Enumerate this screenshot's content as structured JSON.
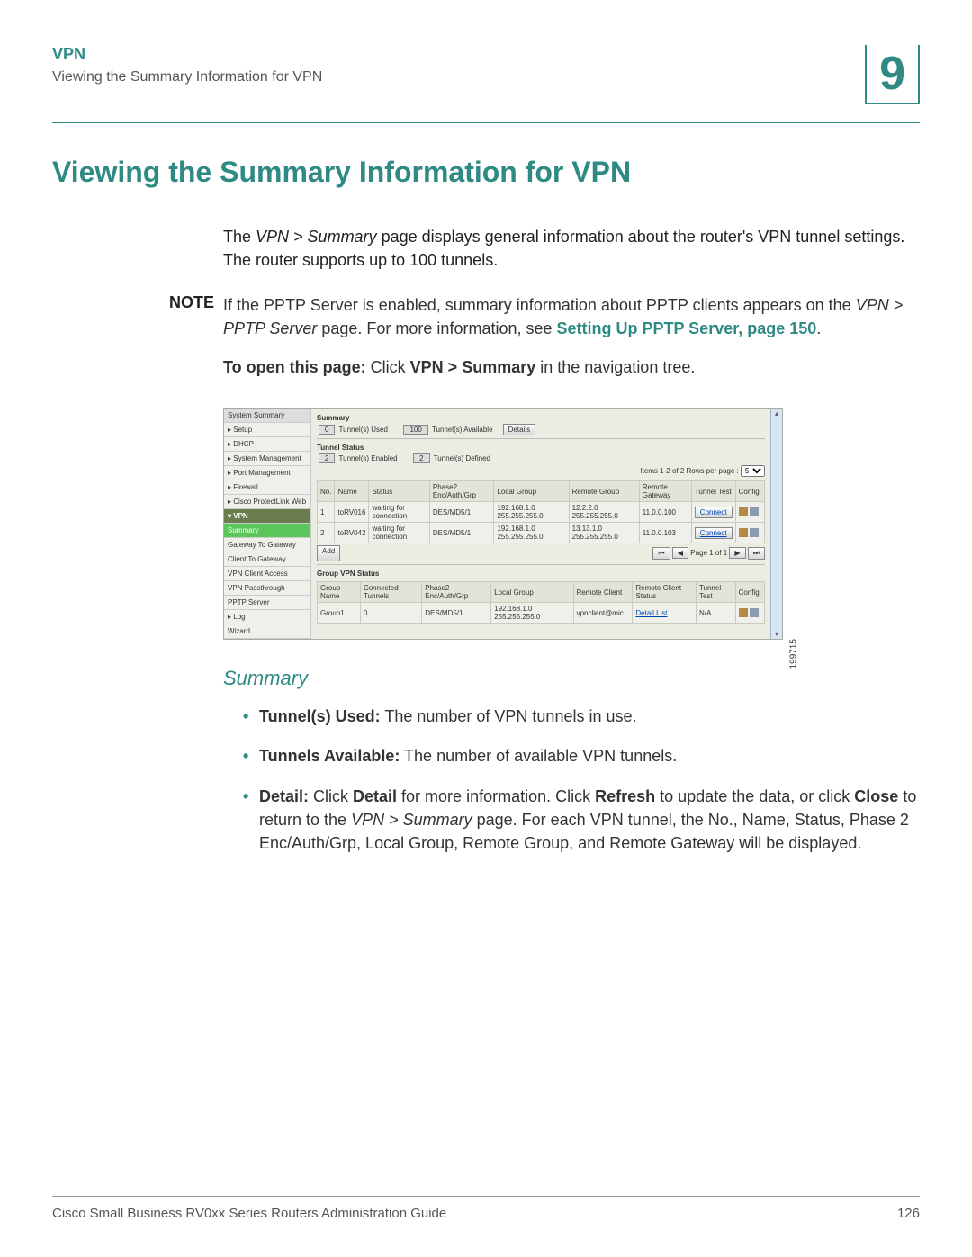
{
  "header": {
    "section": "VPN",
    "subtitle": "Viewing the Summary Information for VPN",
    "chapter": "9"
  },
  "title": "Viewing the Summary Information for VPN",
  "intro": {
    "pre": "The ",
    "path": "VPN > Summary",
    "post": " page displays general information about the router's VPN tunnel settings. The router supports up to 100 tunnels."
  },
  "note": {
    "label": "NOTE",
    "pre": "If the PPTP Server is enabled, summary information about PPTP clients appears on the ",
    "path": "VPN > PPTP Server",
    "post": " page. For more information, see ",
    "link": "Setting Up PPTP Server, page 150",
    "tail": "."
  },
  "open": {
    "lead": "To open this page:",
    "pre": " Click ",
    "path": "VPN > Summary",
    "post": " in the navigation tree."
  },
  "shot": {
    "id": "199715",
    "nav": [
      {
        "label": "System Summary",
        "cls": "top"
      },
      {
        "label": "▸ Setup",
        "cls": ""
      },
      {
        "label": "▸ DHCP",
        "cls": ""
      },
      {
        "label": "▸ System Management",
        "cls": ""
      },
      {
        "label": "▸ Port Management",
        "cls": ""
      },
      {
        "label": "▸ Firewall",
        "cls": ""
      },
      {
        "label": "▸ Cisco ProtectLink Web",
        "cls": ""
      },
      {
        "label": "▾ VPN",
        "cls": "hdr"
      },
      {
        "label": "Summary",
        "cls": "active"
      },
      {
        "label": "Gateway To Gateway",
        "cls": ""
      },
      {
        "label": "Client To Gateway",
        "cls": ""
      },
      {
        "label": "VPN Client Access",
        "cls": ""
      },
      {
        "label": "VPN Passthrough",
        "cls": ""
      },
      {
        "label": "PPTP Server",
        "cls": ""
      },
      {
        "label": "▸ Log",
        "cls": ""
      },
      {
        "label": "Wizard",
        "cls": ""
      }
    ],
    "summary": {
      "title": "Summary",
      "used_val": "0",
      "used_lbl": "Tunnel(s) Used",
      "avail_val": "100",
      "avail_lbl": "Tunnel(s) Available",
      "details_btn": "Details"
    },
    "tunnel_status": {
      "title": "Tunnel Status",
      "enabled_val": "2",
      "enabled_lbl": "Tunnel(s) Enabled",
      "defined_val": "2",
      "defined_lbl": "Tunnel(s) Defined",
      "range": "Items 1-2 of 2  Rows per page :",
      "rows_select": "5",
      "headers": [
        "No.",
        "Name",
        "Status",
        "Phase2 Enc/Auth/Grp",
        "Local Group",
        "Remote Group",
        "Remote Gateway",
        "Tunnel Test",
        "Config."
      ],
      "rows": [
        {
          "no": "1",
          "name": "toRV016",
          "status": "waiting for connection",
          "phase": "DES/MD5/1",
          "local": "192.168.1.0 255.255.255.0",
          "remote": "12.2.2.0 255.255.255.0",
          "gw": "11.0.0.100",
          "test": "Connect"
        },
        {
          "no": "2",
          "name": "toRV042",
          "status": "waiting for connection",
          "phase": "DES/MD5/1",
          "local": "192.168.1.0 255.255.255.0",
          "remote": "13.13.1.0 255.255.255.0",
          "gw": "11.0.0.103",
          "test": "Connect"
        }
      ],
      "add_btn": "Add",
      "paging": "Page 1 of 1"
    },
    "group_vpn": {
      "title": "Group VPN Status",
      "headers": [
        "Group Name",
        "Connected Tunnels",
        "Phase2 Enc/Auth/Grp",
        "Local Group",
        "Remote Client",
        "Remote Client Status",
        "Tunnel Test",
        "Config."
      ],
      "row": {
        "name": "Group1",
        "ct": "0",
        "phase": "DES/MD5/1",
        "local": "192.168.1.0 255.255.255.0",
        "remote": "vpnclient@mic...",
        "status": "Detail List",
        "test": "N/A"
      }
    }
  },
  "summary_section": {
    "heading": "Summary",
    "b1_lead": "Tunnel(s) Used:",
    "b1_text": " The number of VPN tunnels in use.",
    "b2_lead": "Tunnels Available:",
    "b2_text": " The number of available VPN tunnels.",
    "b3_lead": "Detail:",
    "b3_pre": " Click ",
    "b3_d": "Detail",
    "b3_mid1": " for more information. Click ",
    "b3_r": "Refresh",
    "b3_mid2": " to update the data, or click ",
    "b3_c": "Close",
    "b3_mid3": " to return to the ",
    "b3_path": "VPN > Summary",
    "b3_tail": " page. For each VPN tunnel, the No., Name, Status, Phase 2 Enc/Auth/Grp, Local Group, Remote Group, and Remote Gateway will be displayed."
  },
  "footer": {
    "left": "Cisco Small Business RV0xx Series Routers Administration Guide",
    "right": "126"
  }
}
